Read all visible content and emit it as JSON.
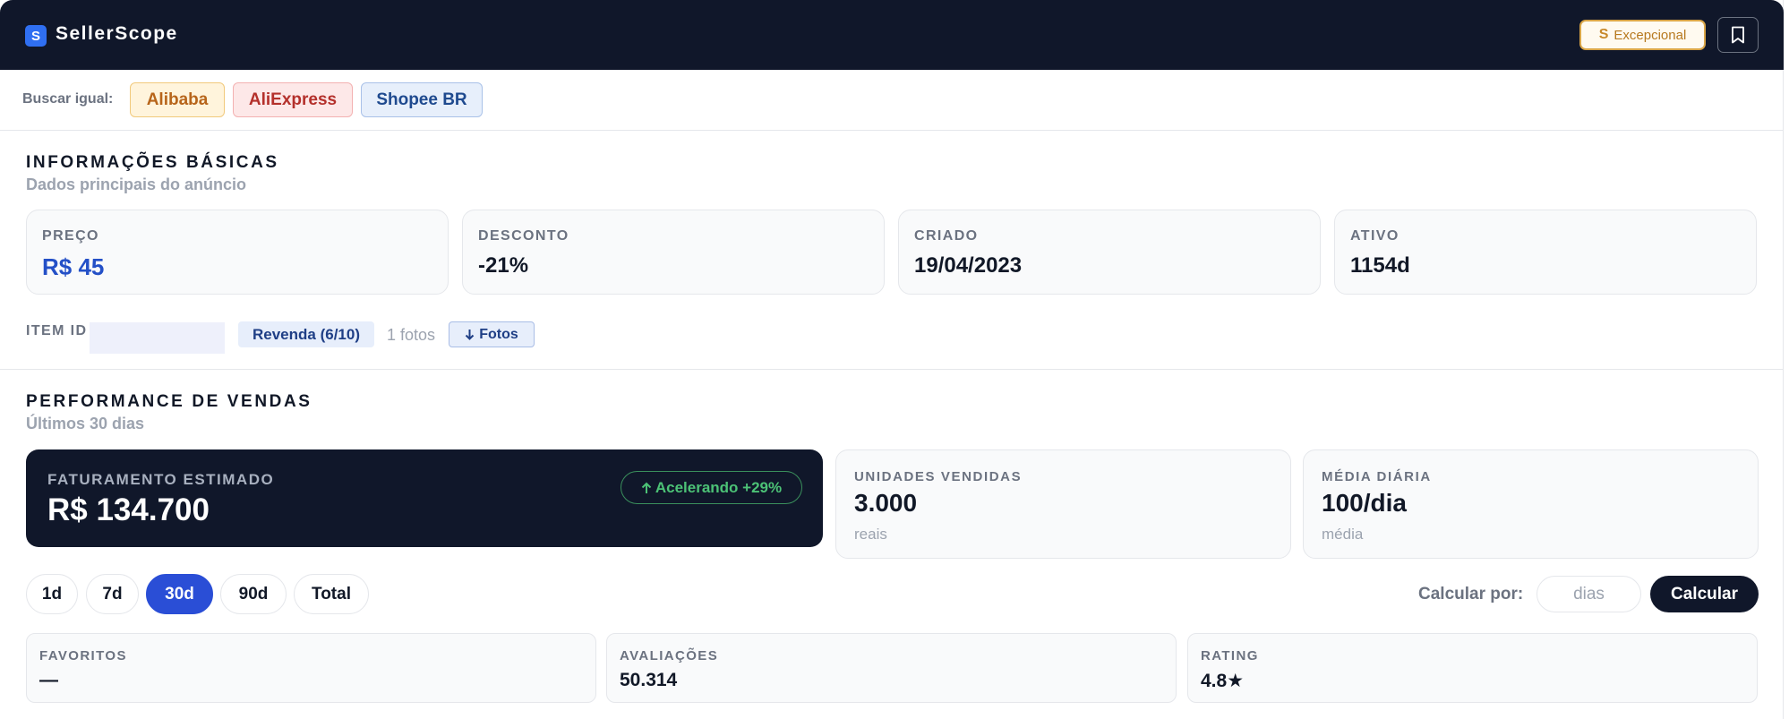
{
  "header": {
    "logo_letter": "S",
    "app_title": "SellerScope",
    "tier_icon_letter": "S",
    "tier_label": "Excepcional",
    "bookmark_icon": "bookmark-icon"
  },
  "search": {
    "label": "Buscar igual:",
    "chips": [
      "Alibaba",
      "AliExpress",
      "Shopee BR"
    ]
  },
  "basic_info": {
    "title": "INFORMAÇÕES BÁSICAS",
    "subtitle": "Dados principais do anúncio",
    "cards": [
      {
        "label": "PREÇO",
        "value": "R$ 45"
      },
      {
        "label": "DESCONTO",
        "value": "-21%"
      },
      {
        "label": "CRIADO",
        "value": "19/04/2023"
      },
      {
        "label": "ATIVO",
        "value": "1154d"
      }
    ],
    "item_id_label": "ITEM ID",
    "resale_badge": "Revenda (6/10)",
    "photos_count": "1 fotos",
    "photos_button": "Fotos"
  },
  "performance": {
    "title": "PERFORMANCE DE VENDAS",
    "subtitle": "Últimos 30 dias",
    "revenue": {
      "label": "FATURAMENTO ESTIMADO",
      "value": "R$ 134.700",
      "trend": "Acelerando +29%"
    },
    "stats": [
      {
        "label": "UNIDADES VENDIDAS",
        "value": "3.000",
        "sub": "reais"
      },
      {
        "label": "MÉDIA DIÁRIA",
        "value": "100/dia",
        "sub": "média"
      }
    ],
    "periods": [
      "1d",
      "7d",
      "30d",
      "90d",
      "Total"
    ],
    "active_period": "30d",
    "calc_label": "Calcular por:",
    "calc_placeholder": "dias",
    "calc_button": "Calcular",
    "metrics": [
      {
        "label": "FAVORITOS",
        "value": "—"
      },
      {
        "label": "AVALIAÇÕES",
        "value": "50.314"
      },
      {
        "label": "RATING",
        "value": "4.8★"
      }
    ]
  },
  "colors": {
    "header_bg": "#10172a",
    "accent_blue": "#2a4ed6",
    "price_blue": "#2450c7",
    "trend_green": "#4cc276",
    "tier_gold": "#d9a547"
  }
}
